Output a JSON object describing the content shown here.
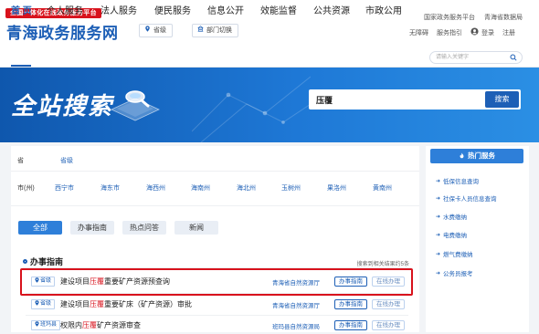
{
  "header": {
    "badge": "全国一体化在线政务服务平台",
    "title": "青海政务服务网",
    "location_button": "省级",
    "dept_button": "部门切换",
    "top_links": [
      "国家政务服务平台",
      "青海省数据局"
    ],
    "accessibility": "无障碍",
    "guide": "服务指引",
    "login": "登录",
    "register": "注册"
  },
  "nav": {
    "items": [
      "首 页",
      "个人服务",
      "法人服务",
      "便民服务",
      "信息公开",
      "效能监督",
      "公共资源",
      "市政公用"
    ],
    "search_placeholder": "请输入关键字"
  },
  "banner": {
    "title": "全站搜索",
    "search_value": "压覆",
    "search_button": "搜索"
  },
  "filters": {
    "province_label": "省",
    "province_value": "省级",
    "city_label": "市(州)",
    "cities": [
      "西宁市",
      "海东市",
      "海西州",
      "海南州",
      "海北州",
      "玉树州",
      "果洛州",
      "黄南州"
    ]
  },
  "tabs": [
    "全部",
    "办事指南",
    "热点问答",
    "新闻"
  ],
  "section": {
    "title": "办事指南",
    "result_count": "搜索到相关结果约5条"
  },
  "results": [
    {
      "tag": "省级",
      "prefix": "建设项目",
      "highlight": "压覆",
      "suffix": "重要矿产资源预查询",
      "dept": "青海省自然资源厅",
      "btn1": "办事指南",
      "btn2": "在线办理"
    },
    {
      "tag": "省级",
      "prefix": "建设项目",
      "highlight": "压覆",
      "suffix": "重要矿床（矿产资源）审批",
      "dept": "青海省自然资源厅",
      "btn1": "办事指南",
      "btn2": "在线办理"
    },
    {
      "tag": "班玛县",
      "prefix": "权限内",
      "highlight": "压覆",
      "suffix": "矿产资源审查",
      "dept": "班玛县自然资源局",
      "btn1": "办事指南",
      "btn2": "在线办理"
    }
  ],
  "sidebar": {
    "title": "热门服务",
    "items": [
      "低保信息查询",
      "社保卡人员信息查询",
      "水费缴纳",
      "电费缴纳",
      "燃气费缴纳",
      "公务员报考"
    ]
  },
  "colors": {
    "brand_blue": "#1d5fb6",
    "highlight_red": "#d8121c"
  }
}
